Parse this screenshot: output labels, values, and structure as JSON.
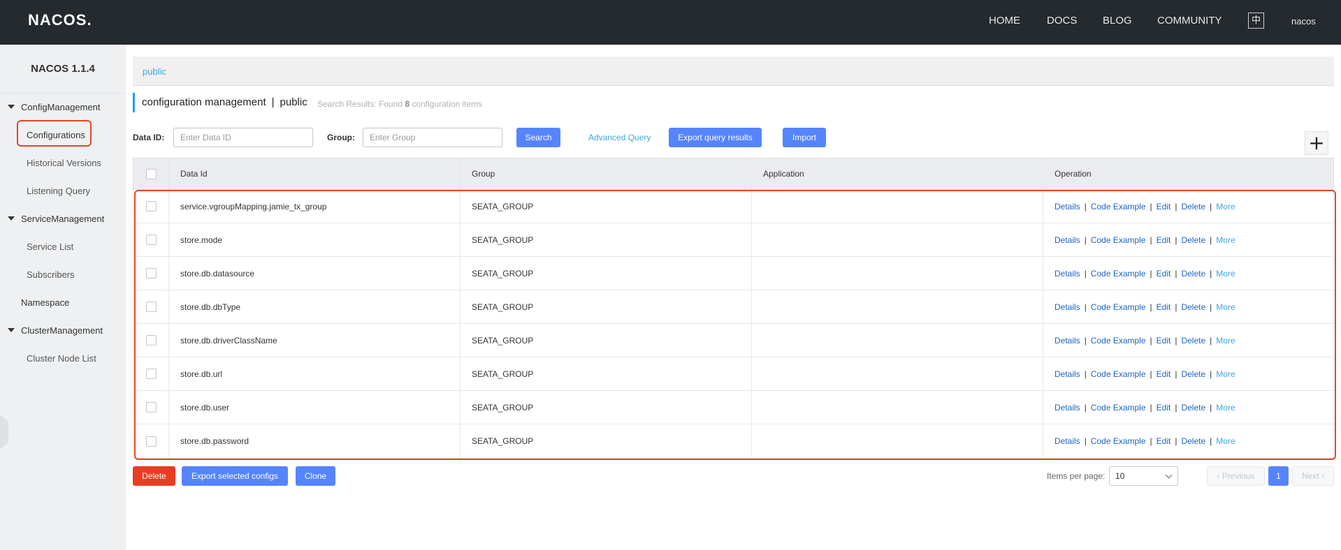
{
  "topnav": {
    "logo": "NACOS.",
    "links": [
      "HOME",
      "DOCS",
      "BLOG",
      "COMMUNITY"
    ],
    "lang": "中",
    "user": "nacos"
  },
  "sidebar": {
    "version": "NACOS 1.1.4",
    "groups": [
      {
        "label": "ConfigManagement",
        "items": [
          "Configurations",
          "Historical Versions",
          "Listening Query"
        ]
      },
      {
        "label": "ServiceManagement",
        "items": [
          "Service List",
          "Subscribers"
        ]
      },
      {
        "label": "Namespace"
      },
      {
        "label": "ClusterManagement",
        "items": [
          "Cluster Node List"
        ]
      }
    ]
  },
  "breadcrumb": "public",
  "header": {
    "title": "configuration management",
    "separator": "|",
    "namespace": "public",
    "search_info_prefix": "Search Results: Found",
    "search_info_count": "8",
    "search_info_suffix": "configuration items"
  },
  "search": {
    "dataid_label": "Data ID:",
    "dataid_placeholder": "Enter Data ID",
    "group_label": "Group:",
    "group_placeholder": "Enter Group",
    "search_btn": "Search",
    "advanced": "Advanced Query",
    "export_btn": "Export query results",
    "import_btn": "Import",
    "plus_icon": "+"
  },
  "table": {
    "columns": [
      "Data Id",
      "Group",
      "Application",
      "Operation"
    ],
    "ops": [
      "Details",
      "Code Example",
      "Edit",
      "Delete",
      "More"
    ],
    "op_sep": "|",
    "rows": [
      {
        "dataid": "service.vgroupMapping.jamie_tx_group",
        "group": "SEATA_GROUP",
        "app": ""
      },
      {
        "dataid": "store.mode",
        "group": "SEATA_GROUP",
        "app": ""
      },
      {
        "dataid": "store.db.datasource",
        "group": "SEATA_GROUP",
        "app": ""
      },
      {
        "dataid": "store.db.dbType",
        "group": "SEATA_GROUP",
        "app": ""
      },
      {
        "dataid": "store.db.driverClassName",
        "group": "SEATA_GROUP",
        "app": ""
      },
      {
        "dataid": "store.db.url",
        "group": "SEATA_GROUP",
        "app": ""
      },
      {
        "dataid": "store.db.user",
        "group": "SEATA_GROUP",
        "app": ""
      },
      {
        "dataid": "store.db.password",
        "group": "SEATA_GROUP",
        "app": ""
      }
    ]
  },
  "footer": {
    "delete_btn": "Delete",
    "export_selected_btn": "Export selected configs",
    "clone_btn": "Clone",
    "items_per_page_label": "Items per page:",
    "items_per_page_value": "10",
    "prev": "Previous",
    "page": "1",
    "next": "Next"
  },
  "colors": {
    "topbar": "#252a2f",
    "primary": "#5584ff",
    "link": "#3ba7dd",
    "highlight": "#e8461f"
  }
}
